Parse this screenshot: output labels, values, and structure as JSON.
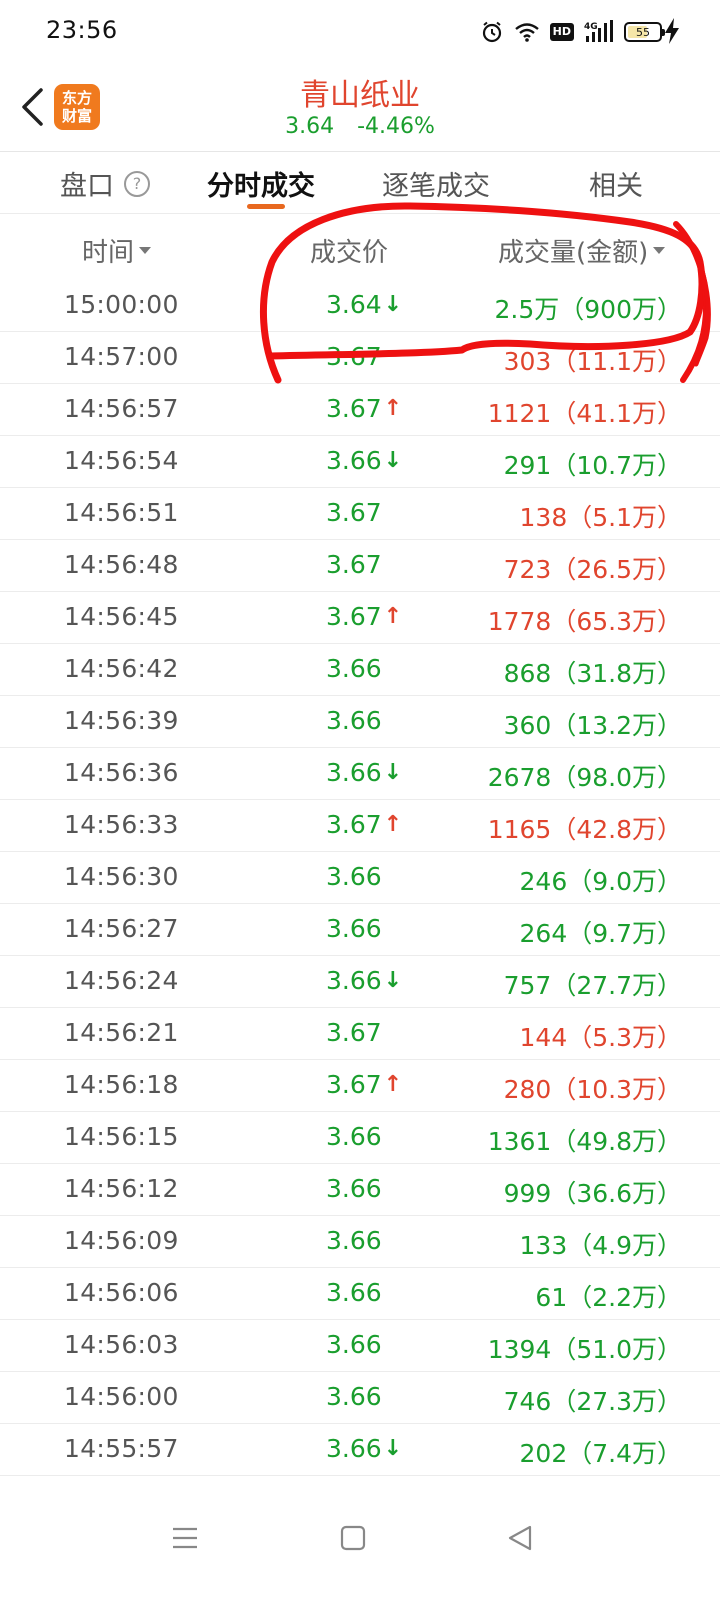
{
  "status_bar": {
    "time": "23:56",
    "battery_level": "55",
    "network": "4G",
    "hd": "HD"
  },
  "header": {
    "logo_line1": "东方",
    "logo_line2": "财富",
    "stock_name": "青山纸业",
    "price": "3.64",
    "change_pct": "-4.46%",
    "price_color": "#1a9e2e",
    "name_color": "#e0452e"
  },
  "tabs": [
    {
      "label": "盘口",
      "active": false
    },
    {
      "label": "分时成交",
      "active": true
    },
    {
      "label": "逐笔成交",
      "active": false
    },
    {
      "label": "相关",
      "active": false
    }
  ],
  "table": {
    "columns": [
      "时间",
      "成交价",
      "成交量(金额)"
    ],
    "rows": [
      {
        "time": "15:00:00",
        "price": "3.64",
        "arrow": "↓",
        "volume": "2.5万（900万）",
        "color": "green"
      },
      {
        "time": "14:57:00",
        "price": "3.67",
        "arrow": "",
        "volume": "303（11.1万）",
        "color": "red"
      },
      {
        "time": "14:56:57",
        "price": "3.67",
        "arrow": "↑",
        "volume": "1121（41.1万）",
        "color": "red"
      },
      {
        "time": "14:56:54",
        "price": "3.66",
        "arrow": "↓",
        "volume": "291（10.7万）",
        "color": "green"
      },
      {
        "time": "14:56:51",
        "price": "3.67",
        "arrow": "",
        "volume": "138（5.1万）",
        "color": "red"
      },
      {
        "time": "14:56:48",
        "price": "3.67",
        "arrow": "",
        "volume": "723（26.5万）",
        "color": "red"
      },
      {
        "time": "14:56:45",
        "price": "3.67",
        "arrow": "↑",
        "volume": "1778（65.3万）",
        "color": "red"
      },
      {
        "time": "14:56:42",
        "price": "3.66",
        "arrow": "",
        "volume": "868（31.8万）",
        "color": "green"
      },
      {
        "time": "14:56:39",
        "price": "3.66",
        "arrow": "",
        "volume": "360（13.2万）",
        "color": "green"
      },
      {
        "time": "14:56:36",
        "price": "3.66",
        "arrow": "↓",
        "volume": "2678（98.0万）",
        "color": "green"
      },
      {
        "time": "14:56:33",
        "price": "3.67",
        "arrow": "↑",
        "volume": "1165（42.8万）",
        "color": "red"
      },
      {
        "time": "14:56:30",
        "price": "3.66",
        "arrow": "",
        "volume": "246（9.0万）",
        "color": "green"
      },
      {
        "time": "14:56:27",
        "price": "3.66",
        "arrow": "",
        "volume": "264（9.7万）",
        "color": "green"
      },
      {
        "time": "14:56:24",
        "price": "3.66",
        "arrow": "↓",
        "volume": "757（27.7万）",
        "color": "green"
      },
      {
        "time": "14:56:21",
        "price": "3.67",
        "arrow": "",
        "volume": "144（5.3万）",
        "color": "red"
      },
      {
        "time": "14:56:18",
        "price": "3.67",
        "arrow": "↑",
        "volume": "280（10.3万）",
        "color": "red"
      },
      {
        "time": "14:56:15",
        "price": "3.66",
        "arrow": "",
        "volume": "1361（49.8万）",
        "color": "green"
      },
      {
        "time": "14:56:12",
        "price": "3.66",
        "arrow": "",
        "volume": "999（36.6万）",
        "color": "green"
      },
      {
        "time": "14:56:09",
        "price": "3.66",
        "arrow": "",
        "volume": "133（4.9万）",
        "color": "green"
      },
      {
        "time": "14:56:06",
        "price": "3.66",
        "arrow": "",
        "volume": "61（2.2万）",
        "color": "green"
      },
      {
        "time": "14:56:03",
        "price": "3.66",
        "arrow": "",
        "volume": "1394（51.0万）",
        "color": "green"
      },
      {
        "time": "14:56:00",
        "price": "3.66",
        "arrow": "",
        "volume": "746（27.3万）",
        "color": "green"
      },
      {
        "time": "14:55:57",
        "price": "3.66",
        "arrow": "↓",
        "volume": "202（7.4万）",
        "color": "green"
      }
    ]
  },
  "colors": {
    "up": "#e0452e",
    "down": "#1a9e2e",
    "accent": "#e8681f",
    "annotation": "#ee1111"
  },
  "icons": {
    "back": "chevron-left-icon",
    "help": "question-circle-icon",
    "nav_menu": "menu-icon",
    "nav_home": "square-home-icon",
    "nav_back": "triangle-back-icon"
  }
}
